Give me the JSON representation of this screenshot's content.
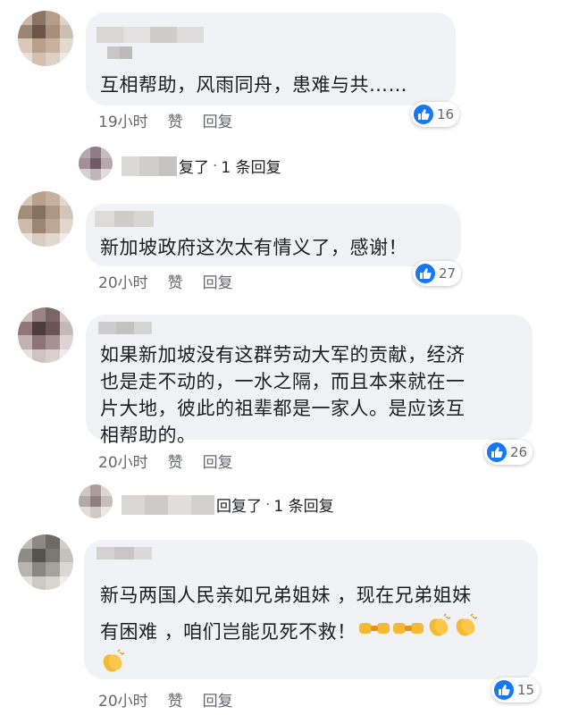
{
  "comments": [
    {
      "text_lines": [
        "互相帮助，风雨同舟，患难与共……"
      ],
      "time": "19小时",
      "like_label": "赞",
      "reply_label": "回复",
      "reactions": "16"
    },
    {
      "text_lines": [
        "新加坡政府这次太有情义了，感谢！"
      ],
      "time": "20小时",
      "like_label": "赞",
      "reply_label": "回复",
      "reactions": "27"
    },
    {
      "text_lines": [
        "如果新加坡没有这群劳动大军的贡献，经济",
        "也是走不动的，一水之隔，而且本来就在一",
        "片大地，彼此的祖辈都是一家人。是应该互",
        "相帮助的。"
      ],
      "time": "20小时",
      "like_label": "赞",
      "reply_label": "回复",
      "reactions": "26"
    },
    {
      "text_lines": [
        "新马两国人民亲如兄弟姐妹 ，现在兄弟姐妹",
        "有困难 ，咱们岂能见死不救！"
      ],
      "time": "20小时",
      "like_label": "赞",
      "reply_label": "回复",
      "reactions": "15"
    }
  ],
  "replies": [
    {
      "text": "复了",
      "sep": "·",
      "count": "1 条回复"
    },
    {
      "text": "回复了",
      "sep": "·",
      "count": "1 条回复"
    }
  ],
  "icons": {
    "like": "thumbs-up-icon",
    "reply_arrow": "reply-arrow-icon",
    "fist_bump": "fist-bump-emoji",
    "clap": "clapping-hands-emoji"
  },
  "colors": {
    "like_blue": "#1877f2",
    "bubble_bg": "#f0f2f5",
    "meta_gray": "#65676b"
  }
}
